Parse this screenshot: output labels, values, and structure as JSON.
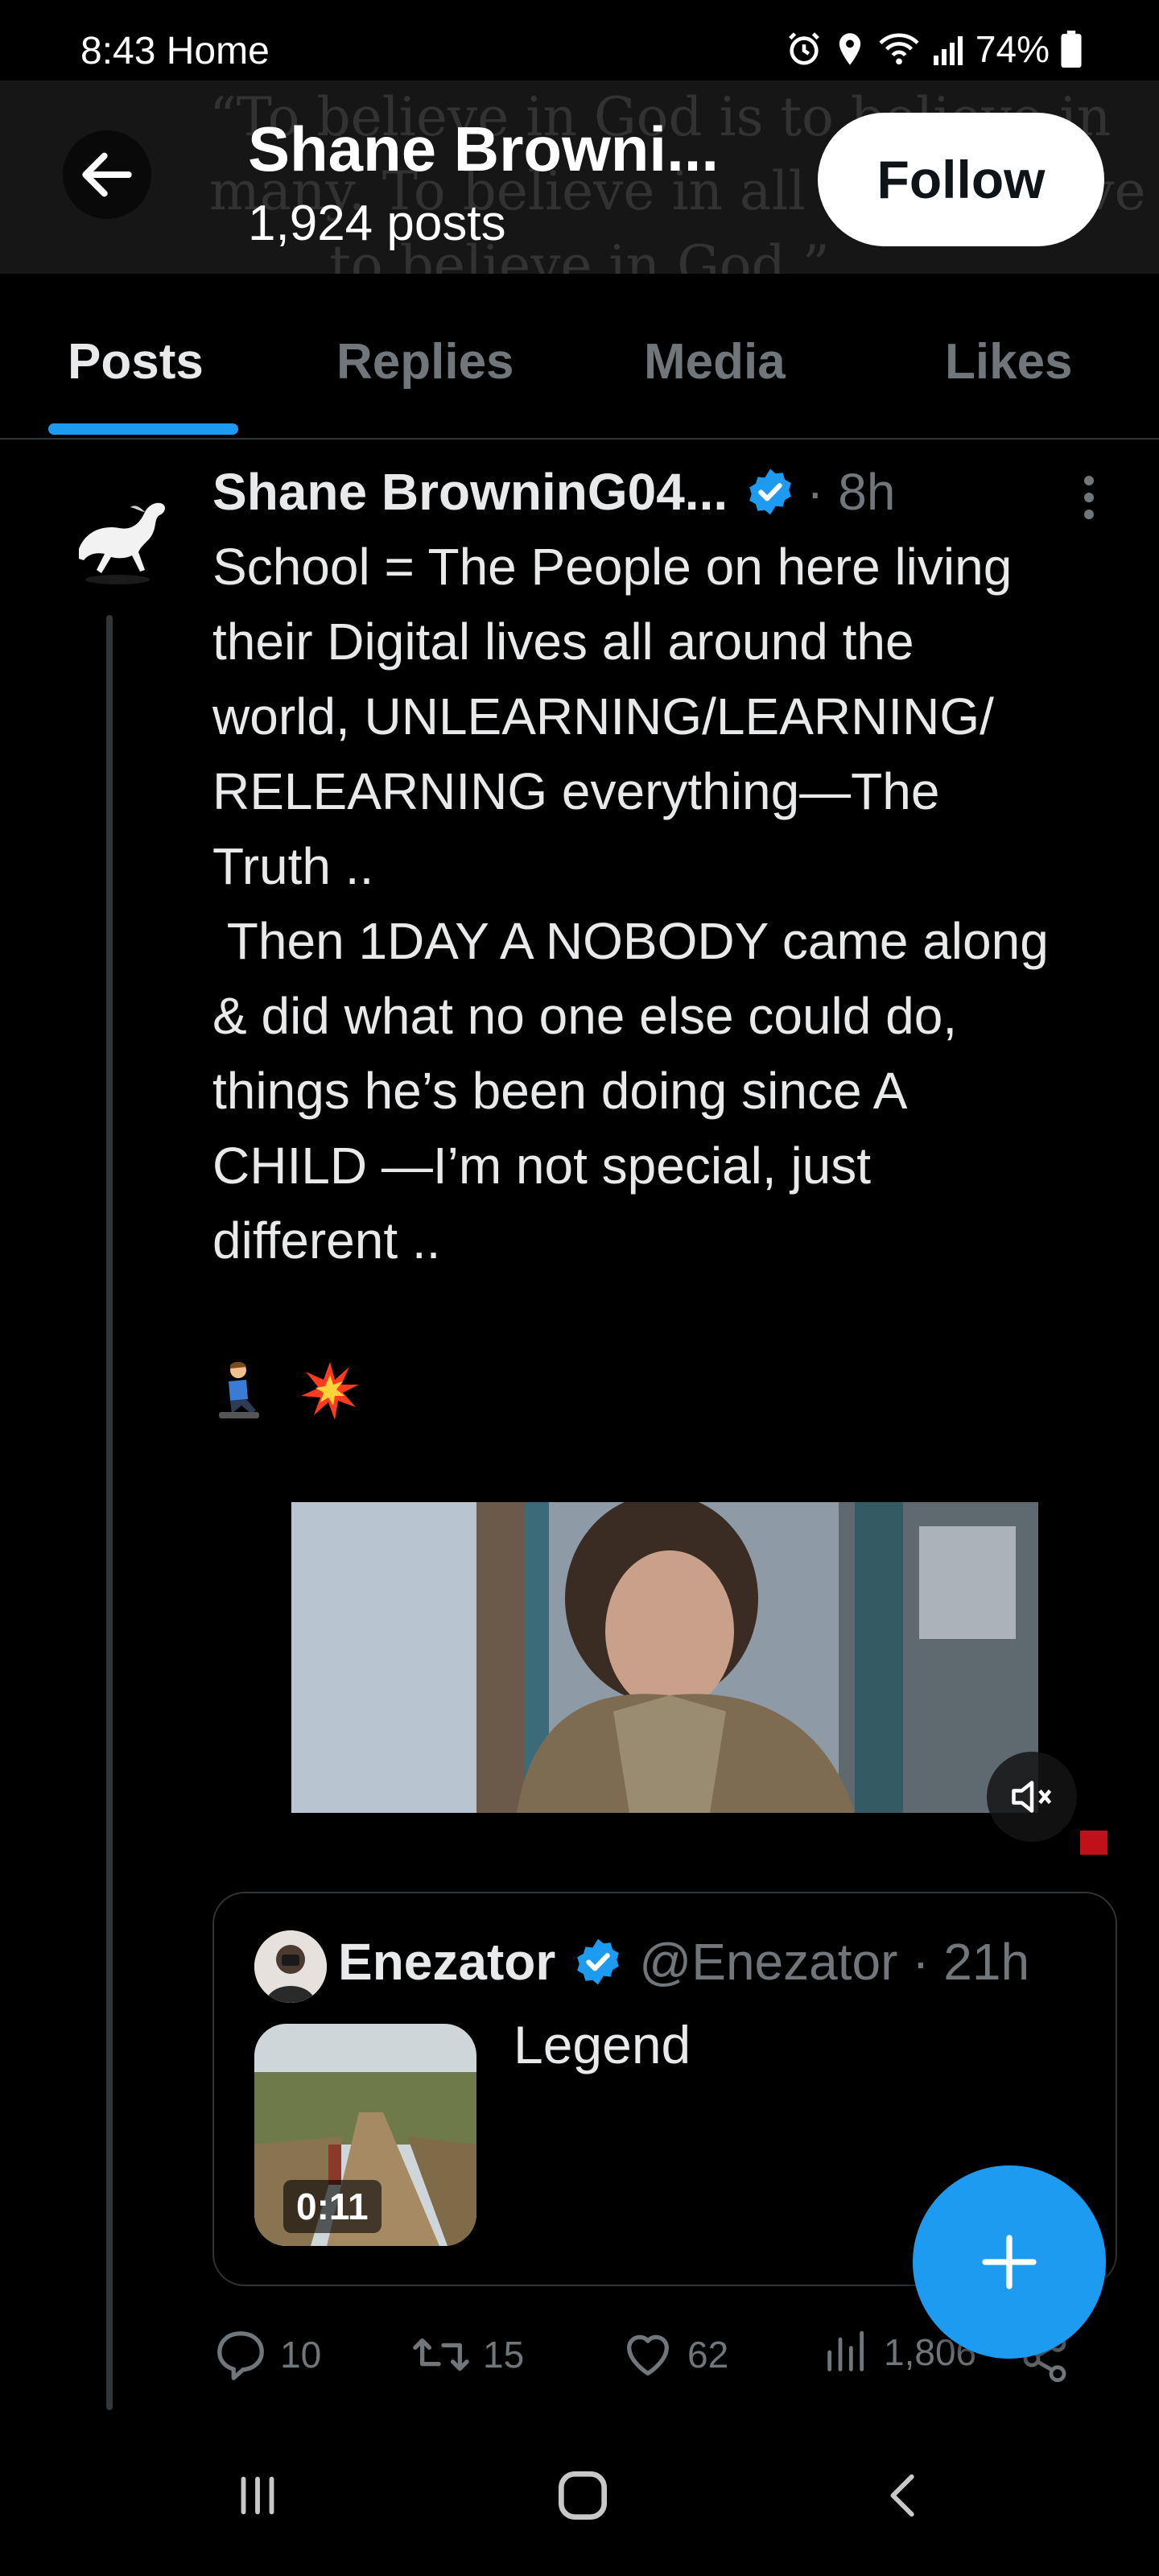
{
  "status_bar": {
    "time": "8:43",
    "label": "Home",
    "battery": "74%",
    "icons": [
      "alarm-icon",
      "location-icon",
      "wifi-icon",
      "signal-icon",
      "battery-icon"
    ]
  },
  "header": {
    "name": "Shane Browni...",
    "post_count": "1,924 posts",
    "follow_label": "Follow",
    "banner_text": [
      "“To believe in God is to believe in",
      "many. To believe in all is to believe in",
      "to believe in God.”"
    ]
  },
  "tabs": [
    {
      "label": "Posts",
      "active": true
    },
    {
      "label": "Replies",
      "active": false
    },
    {
      "label": "Media",
      "active": false
    },
    {
      "label": "Likes",
      "active": false
    }
  ],
  "post": {
    "author": "Shane BrowninG04...",
    "time": "· 8h",
    "text": "School = The People on here living\ntheir Digital lives all around the\nworld, UNLEARNING/LEARNING/\nRELEARNING everything—The\nTruth ..\n Then 1DAY A NOBODY came along\n& did what no one else could do,\nthings he’s been doing since A\nCHILD —I’m not special, just\ndifferent ..",
    "emoji": [
      "🧎‍♂️",
      "💥"
    ],
    "quote": {
      "name": "Enezator",
      "handle_time": "@Enezator · 21h",
      "text": "Legend",
      "duration": "0:11"
    },
    "stats": {
      "replies": "10",
      "reposts": "15",
      "likes": "62",
      "views": "1,806"
    }
  },
  "colors": {
    "accent": "#1d9bf0",
    "muted": "#71767b",
    "text": "#e7e9ea",
    "background": "#000000"
  }
}
